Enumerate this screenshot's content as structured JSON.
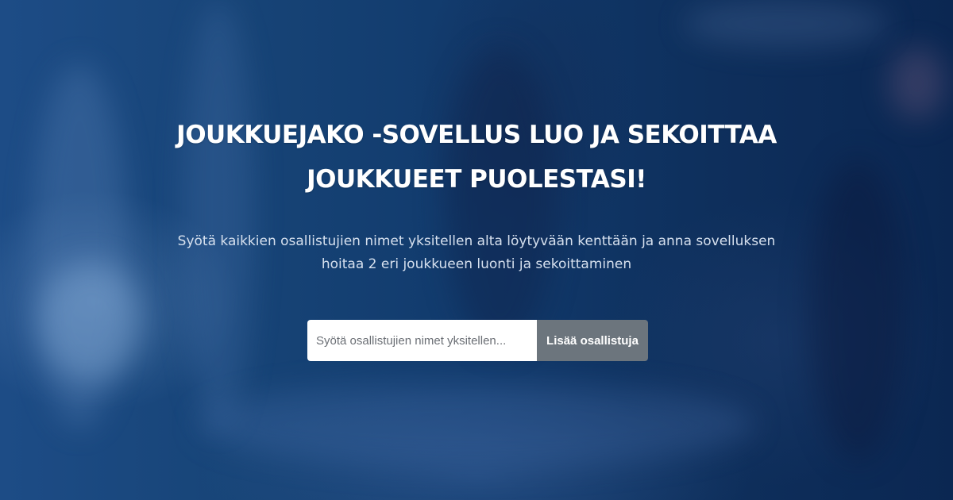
{
  "hero": {
    "headline_line1": "JOUKKUEJAKO -SOVELLUS LUO JA SEKOITTAA",
    "headline_line2": "JOUKKUEET PUOLESTASI!",
    "description_line1": "Syötä kaikkien osallistujien nimet yksitellen alta löytyvään kenttään ja anna sovelluksen",
    "description_line2": "hoitaa 2 eri joukkueen luonti ja sekoittaminen"
  },
  "form": {
    "input_value": "",
    "input_placeholder": "Syötä osallistujien nimet yksitellen...",
    "add_button_label": "Lisää osallistuja"
  },
  "colors": {
    "background": "#123a6b",
    "headline": "#ffffff",
    "description": "#d6e0ee",
    "button": "#6c757d",
    "input": "#ffffff"
  }
}
